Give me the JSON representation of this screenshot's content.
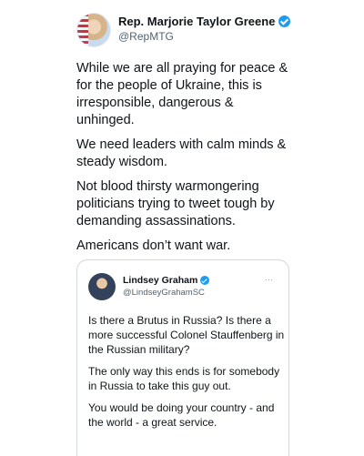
{
  "author": {
    "display_name": "Rep. Marjorie Taylor Greene",
    "handle": "@RepMTG",
    "verified_icon": "verified-badge-icon",
    "more_icon": "more-options-icon"
  },
  "tweet_paragraphs": [
    "While we are all praying for peace & for the people of Ukraine, this is irresponsible, dangerous & unhinged.",
    "We need leaders with calm minds & steady wisdom.",
    "Not blood thirsty warmongering politicians trying to tweet tough by demanding assassinations.",
    "Americans don’t want war."
  ],
  "quoted": {
    "display_name": "Lindsey Graham",
    "handle": "@LindseyGrahamSC",
    "paragraphs": [
      "Is there a Brutus in Russia?  Is there a more successful Colonel Stauffenberg in the Russian military?",
      "The only way this ends is for somebody in Russia to take this guy out.",
      "You would be doing your country - and the world - a great service."
    ]
  },
  "colors": {
    "verified": "#1d9bf0",
    "text": "#0f1419",
    "secondary": "#536471",
    "border": "#cfd9de"
  }
}
